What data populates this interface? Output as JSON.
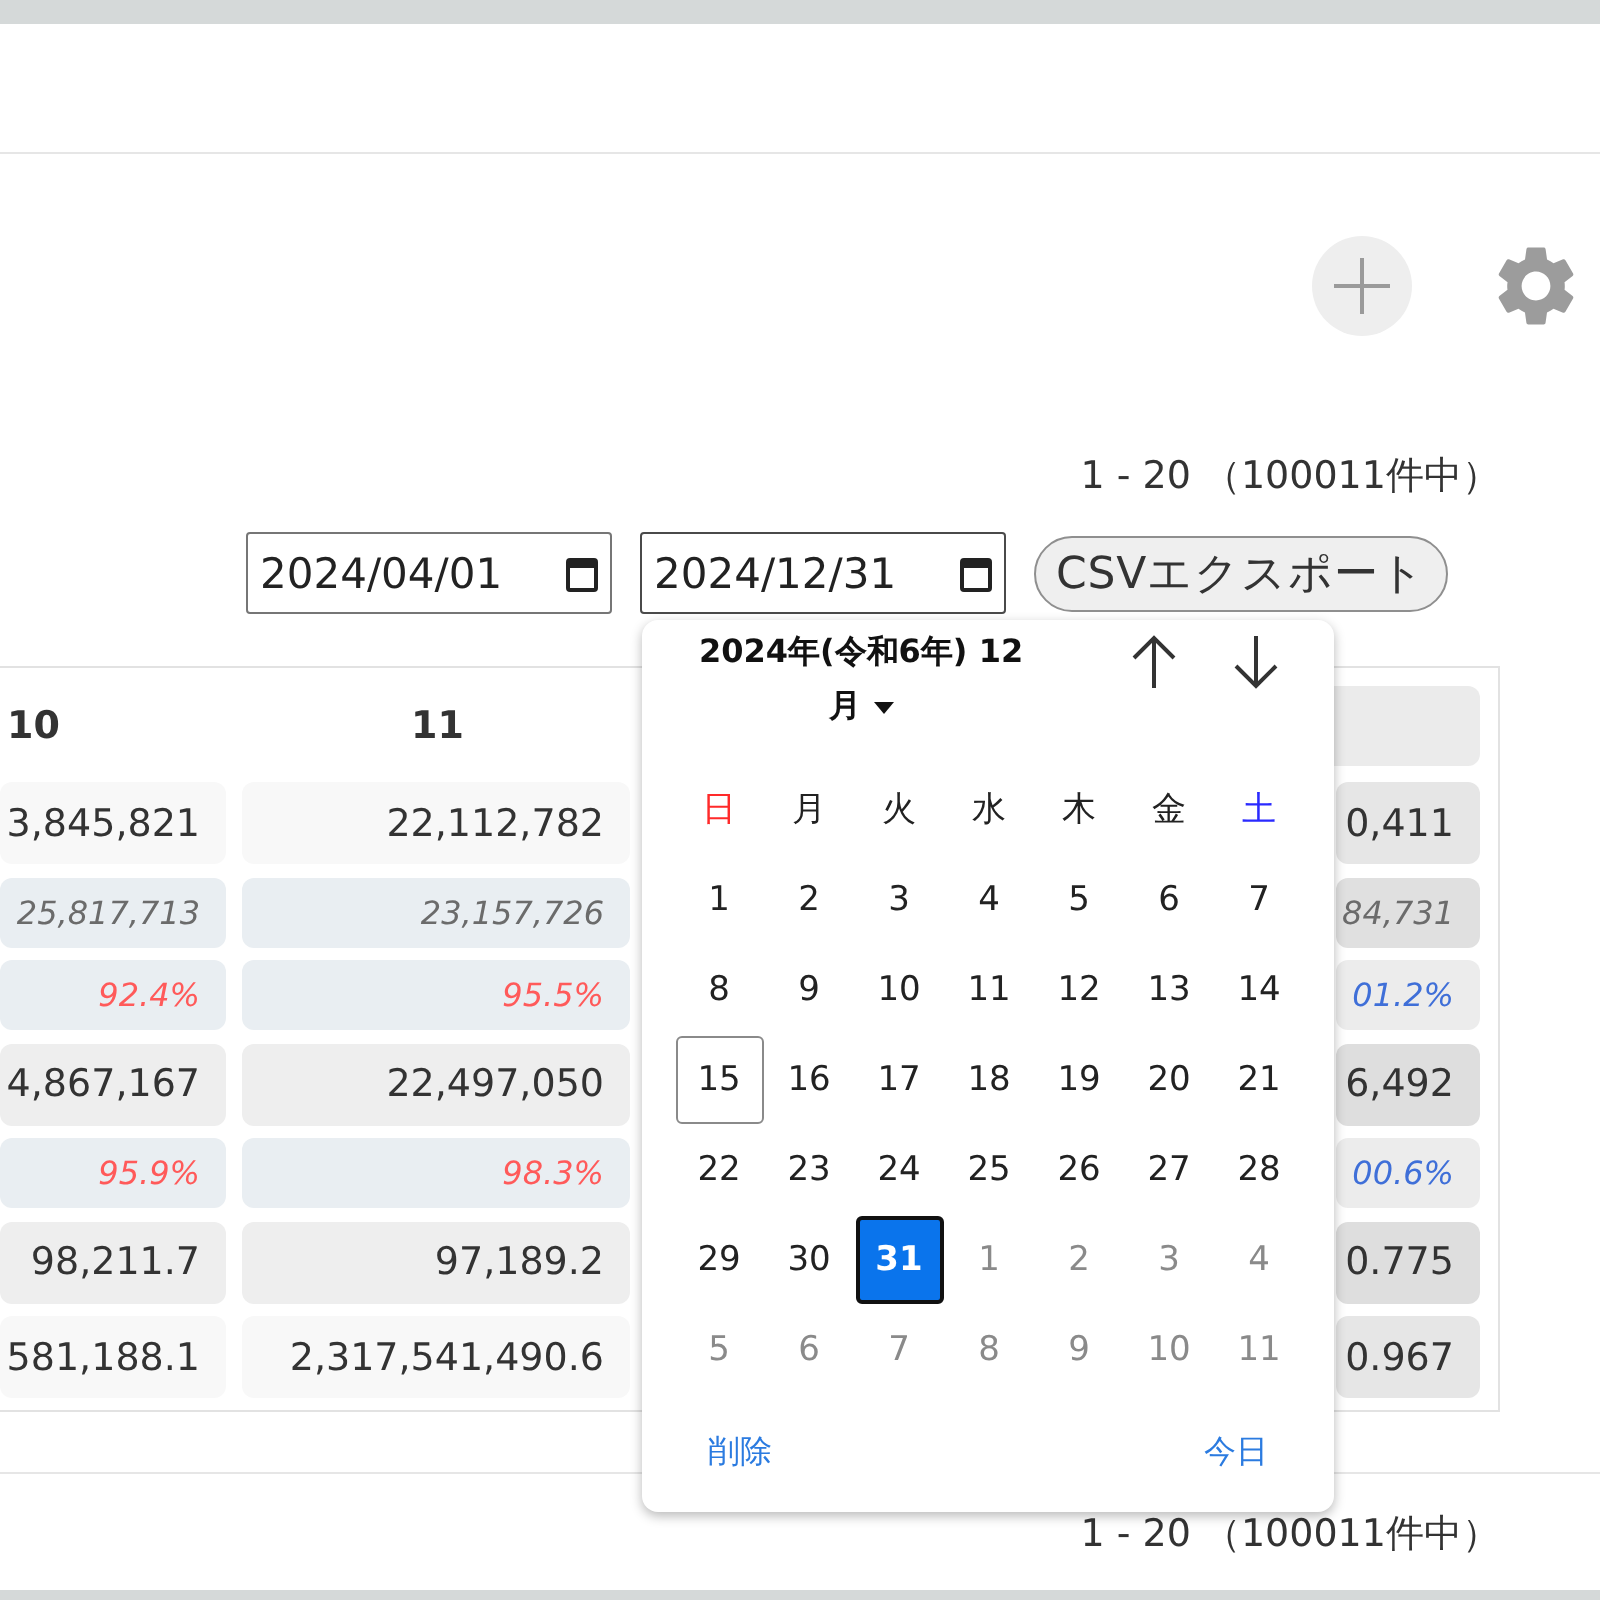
{
  "pagination_top": "1 - 20 （100011件中）",
  "filters": {
    "date_from": "2024/04/01",
    "date_to": "2024/12/31",
    "export_button": "CSVエクスポート"
  },
  "table": {
    "columns": [
      {
        "label": "10",
        "highlighted": false
      },
      {
        "label": "11",
        "highlighted": false
      },
      {
        "highlighted": true
      }
    ],
    "rows": [
      {
        "kind": "light",
        "cells": [
          {
            "text": "3,845,821"
          },
          {
            "text": "22,112,782"
          },
          {
            "text": "0,411"
          }
        ]
      },
      {
        "kind": "sub",
        "cells": [
          {
            "text": "25,817,713"
          },
          {
            "text": "23,157,726"
          },
          {
            "text": "84,731"
          }
        ]
      },
      {
        "kind": "rate",
        "cells": [
          {
            "text": "92.4%",
            "color": "#ff5a5a"
          },
          {
            "text": "95.5%",
            "color": "#ff5a5a"
          },
          {
            "text": "01.2%",
            "color": "#3f6fd8"
          }
        ]
      },
      {
        "kind": "value",
        "cells": [
          {
            "text": "4,867,167"
          },
          {
            "text": "22,497,050"
          },
          {
            "text": "6,492"
          }
        ]
      },
      {
        "kind": "rate",
        "cells": [
          {
            "text": "95.9%",
            "color": "#ff5a5a"
          },
          {
            "text": "98.3%",
            "color": "#ff5a5a"
          },
          {
            "text": "00.6%",
            "color": "#3f6fd8"
          }
        ]
      },
      {
        "kind": "value",
        "cells": [
          {
            "text": "98,211.7"
          },
          {
            "text": "97,189.2"
          },
          {
            "text": "0.775"
          }
        ]
      },
      {
        "kind": "light",
        "cells": [
          {
            "text": "581,188.1"
          },
          {
            "text": "2,317,541,490.6"
          },
          {
            "text": "0.967"
          }
        ]
      }
    ]
  },
  "date_picker": {
    "open": true,
    "title": "2024年(令和6年) 12月",
    "weekdays": [
      {
        "label": "日",
        "kind": "sunday"
      },
      {
        "label": "月",
        "kind": "weekday"
      },
      {
        "label": "火",
        "kind": "weekday"
      },
      {
        "label": "水",
        "kind": "weekday"
      },
      {
        "label": "木",
        "kind": "weekday"
      },
      {
        "label": "金",
        "kind": "weekday"
      },
      {
        "label": "土",
        "kind": "saturday"
      }
    ],
    "weeks": [
      [
        {
          "day": "1",
          "outside": false,
          "today": false,
          "selected": false
        },
        {
          "day": "2",
          "outside": false,
          "today": false,
          "selected": false
        },
        {
          "day": "3",
          "outside": false,
          "today": false,
          "selected": false
        },
        {
          "day": "4",
          "outside": false,
          "today": false,
          "selected": false
        },
        {
          "day": "5",
          "outside": false,
          "today": false,
          "selected": false
        },
        {
          "day": "6",
          "outside": false,
          "today": false,
          "selected": false
        },
        {
          "day": "7",
          "outside": false,
          "today": false,
          "selected": false
        }
      ],
      [
        {
          "day": "8",
          "outside": false,
          "today": false,
          "selected": false
        },
        {
          "day": "9",
          "outside": false,
          "today": false,
          "selected": false
        },
        {
          "day": "10",
          "outside": false,
          "today": false,
          "selected": false
        },
        {
          "day": "11",
          "outside": false,
          "today": false,
          "selected": false
        },
        {
          "day": "12",
          "outside": false,
          "today": false,
          "selected": false
        },
        {
          "day": "13",
          "outside": false,
          "today": false,
          "selected": false
        },
        {
          "day": "14",
          "outside": false,
          "today": false,
          "selected": false
        }
      ],
      [
        {
          "day": "15",
          "outside": false,
          "today": true,
          "selected": false
        },
        {
          "day": "16",
          "outside": false,
          "today": false,
          "selected": false
        },
        {
          "day": "17",
          "outside": false,
          "today": false,
          "selected": false
        },
        {
          "day": "18",
          "outside": false,
          "today": false,
          "selected": false
        },
        {
          "day": "19",
          "outside": false,
          "today": false,
          "selected": false
        },
        {
          "day": "20",
          "outside": false,
          "today": false,
          "selected": false
        },
        {
          "day": "21",
          "outside": false,
          "today": false,
          "selected": false
        }
      ],
      [
        {
          "day": "22",
          "outside": false,
          "today": false,
          "selected": false
        },
        {
          "day": "23",
          "outside": false,
          "today": false,
          "selected": false
        },
        {
          "day": "24",
          "outside": false,
          "today": false,
          "selected": false
        },
        {
          "day": "25",
          "outside": false,
          "today": false,
          "selected": false
        },
        {
          "day": "26",
          "outside": false,
          "today": false,
          "selected": false
        },
        {
          "day": "27",
          "outside": false,
          "today": false,
          "selected": false
        },
        {
          "day": "28",
          "outside": false,
          "today": false,
          "selected": false
        }
      ],
      [
        {
          "day": "29",
          "outside": false,
          "today": false,
          "selected": false
        },
        {
          "day": "30",
          "outside": false,
          "today": false,
          "selected": false
        },
        {
          "day": "31",
          "outside": false,
          "today": false,
          "selected": true
        },
        {
          "day": "1",
          "outside": true,
          "today": false,
          "selected": false
        },
        {
          "day": "2",
          "outside": true,
          "today": false,
          "selected": false
        },
        {
          "day": "3",
          "outside": true,
          "today": false,
          "selected": false
        },
        {
          "day": "4",
          "outside": true,
          "today": false,
          "selected": false
        }
      ],
      [
        {
          "day": "5",
          "outside": true,
          "today": false,
          "selected": false
        },
        {
          "day": "6",
          "outside": true,
          "today": false,
          "selected": false
        },
        {
          "day": "7",
          "outside": true,
          "today": false,
          "selected": false
        },
        {
          "day": "8",
          "outside": true,
          "today": false,
          "selected": false
        },
        {
          "day": "9",
          "outside": true,
          "today": false,
          "selected": false
        },
        {
          "day": "10",
          "outside": true,
          "today": false,
          "selected": false
        },
        {
          "day": "11",
          "outside": true,
          "today": false,
          "selected": false
        }
      ]
    ],
    "clear_button": "削除",
    "today_button": "今日"
  },
  "pagination_bottom": "1 - 20 （100011件中）"
}
